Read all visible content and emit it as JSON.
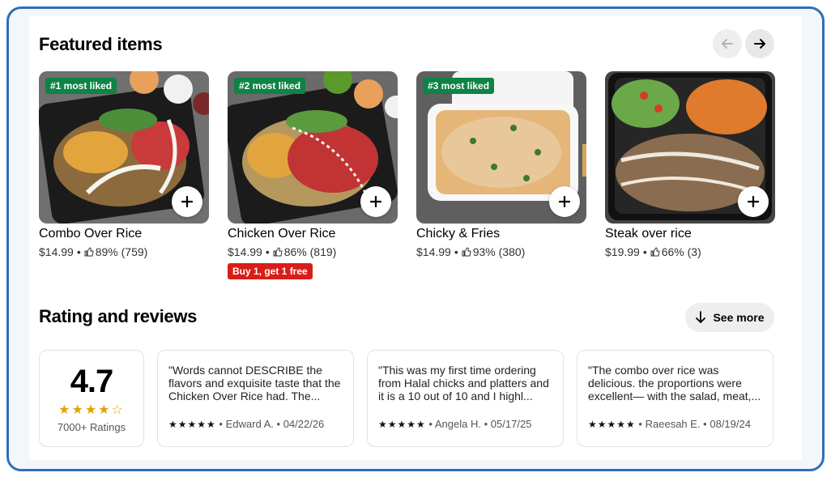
{
  "featured": {
    "title": "Featured items",
    "items": [
      {
        "name": "Combo Over Rice",
        "badge": "#1 most liked",
        "price": "$14.99",
        "rating": "89% (759)",
        "promo": ""
      },
      {
        "name": "Chicken Over Rice",
        "badge": "#2 most liked",
        "price": "$14.99",
        "rating": "86% (819)",
        "promo": "Buy 1, get 1 free"
      },
      {
        "name": "Chicky & Fries",
        "badge": "#3 most liked",
        "price": "$14.99",
        "rating": "93% (380)",
        "promo": ""
      },
      {
        "name": "Steak over rice",
        "badge": "",
        "price": "$19.99",
        "rating": "66% (3)",
        "promo": ""
      }
    ],
    "separator": "•"
  },
  "reviews": {
    "title": "Rating and reviews",
    "see_more": "See more",
    "score": "4.7",
    "stars": "★★★★☆",
    "count": "7000+ Ratings",
    "items": [
      {
        "text": "\"Words cannot DESCRIBE the flavors and exquisite taste that the Chicken Over Rice had. The...",
        "stars": "★★★★★",
        "author": "Edward A.",
        "date": "04/22/26"
      },
      {
        "text": "\"This was my first time ordering from Halal chicks and platters and it is a 10 out of 10 and I highl...",
        "stars": "★★★★★",
        "author": "Angela H.",
        "date": "05/17/25"
      },
      {
        "text": "\"The combo over rice was delicious. the proportions were excellent— with the salad, meat,...",
        "stars": "★★★★★",
        "author": "Raeesah E.",
        "date": "08/19/24"
      }
    ]
  },
  "colors": {
    "frame_border": "#2f6fb5",
    "badge_green": "#0e8345",
    "promo_red": "#d91e18",
    "star_gold": "#e0a400"
  },
  "icons": {
    "prev": "arrow-left-icon",
    "next": "arrow-right-icon",
    "add": "plus-icon",
    "like": "thumbs-up-icon",
    "see_more": "arrow-down-icon"
  }
}
